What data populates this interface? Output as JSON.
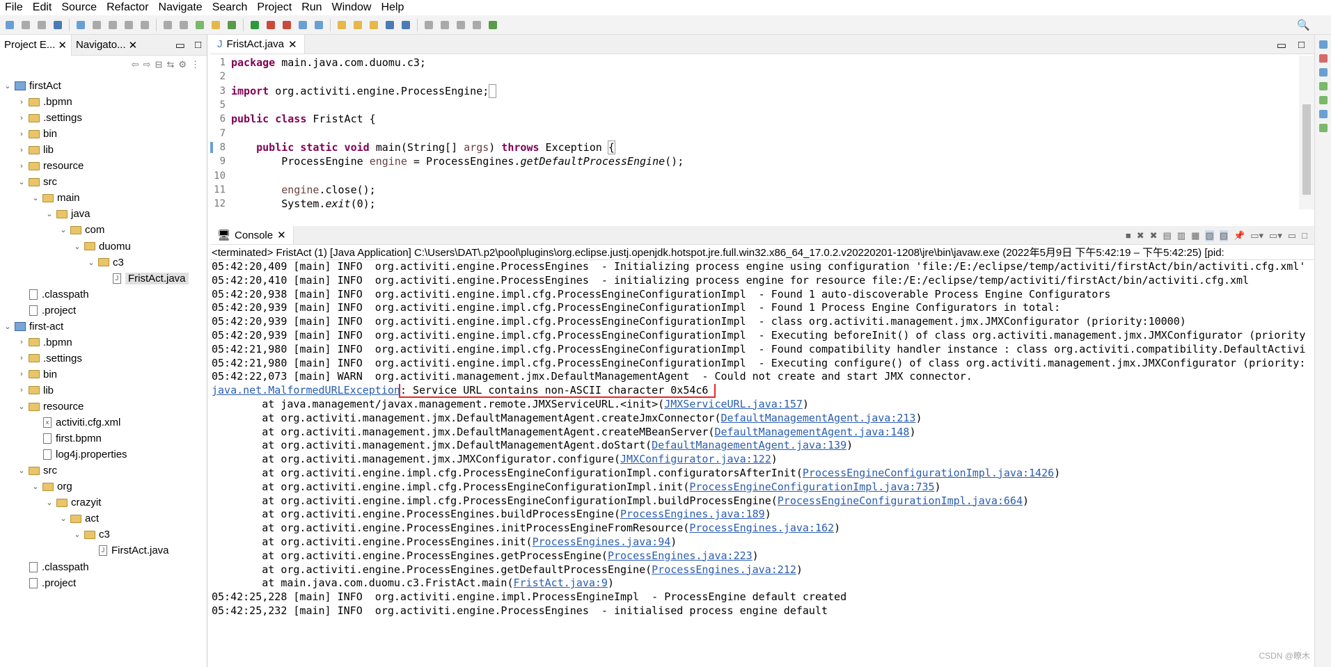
{
  "menu": [
    "File",
    "Edit",
    "Source",
    "Refactor",
    "Navigate",
    "Search",
    "Project",
    "Run",
    "Window",
    "Help"
  ],
  "left_panel": {
    "tabs": [
      "Project E...",
      "Navigato..."
    ],
    "tree": [
      {
        "label": "firstAct",
        "depth": 0,
        "type": "project",
        "expanded": true
      },
      {
        "label": ".bpmn",
        "depth": 1,
        "type": "folder"
      },
      {
        "label": ".settings",
        "depth": 1,
        "type": "folder"
      },
      {
        "label": "bin",
        "depth": 1,
        "type": "folder"
      },
      {
        "label": "lib",
        "depth": 1,
        "type": "folder"
      },
      {
        "label": "resource",
        "depth": 1,
        "type": "folder"
      },
      {
        "label": "src",
        "depth": 1,
        "type": "folder",
        "expanded": true
      },
      {
        "label": "main",
        "depth": 2,
        "type": "folder",
        "expanded": true
      },
      {
        "label": "java",
        "depth": 3,
        "type": "folder",
        "expanded": true
      },
      {
        "label": "com",
        "depth": 4,
        "type": "folder",
        "expanded": true
      },
      {
        "label": "duomu",
        "depth": 5,
        "type": "folder",
        "expanded": true
      },
      {
        "label": "c3",
        "depth": 6,
        "type": "folder",
        "expanded": true
      },
      {
        "label": "FristAct.java",
        "depth": 7,
        "type": "file",
        "selected": true
      },
      {
        "label": ".classpath",
        "depth": 1,
        "type": "file"
      },
      {
        "label": ".project",
        "depth": 1,
        "type": "file"
      },
      {
        "label": "first-act",
        "depth": 0,
        "type": "project",
        "expanded": true
      },
      {
        "label": ".bpmn",
        "depth": 1,
        "type": "folder"
      },
      {
        "label": ".settings",
        "depth": 1,
        "type": "folder"
      },
      {
        "label": "bin",
        "depth": 1,
        "type": "folder"
      },
      {
        "label": "lib",
        "depth": 1,
        "type": "folder"
      },
      {
        "label": "resource",
        "depth": 1,
        "type": "folder",
        "expanded": true
      },
      {
        "label": "activiti.cfg.xml",
        "depth": 2,
        "type": "file"
      },
      {
        "label": "first.bpmn",
        "depth": 2,
        "type": "file"
      },
      {
        "label": "log4j.properties",
        "depth": 2,
        "type": "file"
      },
      {
        "label": "src",
        "depth": 1,
        "type": "folder",
        "expanded": true
      },
      {
        "label": "org",
        "depth": 2,
        "type": "folder",
        "expanded": true
      },
      {
        "label": "crazyit",
        "depth": 3,
        "type": "folder",
        "expanded": true
      },
      {
        "label": "act",
        "depth": 4,
        "type": "folder",
        "expanded": true
      },
      {
        "label": "c3",
        "depth": 5,
        "type": "folder",
        "expanded": true
      },
      {
        "label": "FirstAct.java",
        "depth": 6,
        "type": "file"
      },
      {
        "label": ".classpath",
        "depth": 1,
        "type": "file"
      },
      {
        "label": ".project",
        "depth": 1,
        "type": "file"
      }
    ]
  },
  "editor": {
    "tab": "FristAct.java",
    "lines": [
      {
        "n": "1",
        "html": "<span class='kw'>package</span> main.java.com.duomu.c3;"
      },
      {
        "n": "2",
        "html": ""
      },
      {
        "n": "3",
        "html": "<span class='kw'>import</span> org.activiti.engine.ProcessEngine;<span style='border:1px solid #999'>&nbsp;</span>"
      },
      {
        "n": "5",
        "html": ""
      },
      {
        "n": "6",
        "html": "<span class='kw'>public class</span> FristAct {"
      },
      {
        "n": "7",
        "html": ""
      },
      {
        "n": "8",
        "html": "    <span class='kw'>public static void</span> main(String[] <span class='par'>args</span>) <span class='kw'>throws</span> Exception <span style='outline:1px solid #999'>{</span>"
      },
      {
        "n": "9",
        "html": "        ProcessEngine <span class='par'>engine</span> = ProcessEngines.<span class='it'>getDefaultProcessEngine</span>();"
      },
      {
        "n": "10",
        "html": ""
      },
      {
        "n": "11",
        "html": "        <span class='par'>engine</span>.close();"
      },
      {
        "n": "12",
        "html": "        System.<span class='it'>exit</span>(0);"
      }
    ]
  },
  "console": {
    "tab": "Console",
    "terminated": "<terminated> FristAct (1) [Java Application] C:\\Users\\DAT\\.p2\\pool\\plugins\\org.eclipse.justj.openjdk.hotspot.jre.full.win32.x86_64_17.0.2.v20220201-1208\\jre\\bin\\javaw.exe  (2022年5月9日 下午5:42:19 – 下午5:42:25) [pid:",
    "lines": [
      {
        "t": "05:42:20,409 [main] INFO  org.activiti.engine.ProcessEngines  - Initializing process engine using configuration 'file:/E:/eclipse/temp/activiti/firstAct/bin/activiti.cfg.xml'"
      },
      {
        "t": "05:42:20,410 [main] INFO  org.activiti.engine.ProcessEngines  - initializing process engine for resource file:/E:/eclipse/temp/activiti/firstAct/bin/activiti.cfg.xml"
      },
      {
        "t": "05:42:20,938 [main] INFO  org.activiti.engine.impl.cfg.ProcessEngineConfigurationImpl  - Found 1 auto-discoverable Process Engine Configurators"
      },
      {
        "t": "05:42:20,939 [main] INFO  org.activiti.engine.impl.cfg.ProcessEngineConfigurationImpl  - Found 1 Process Engine Configurators in total:"
      },
      {
        "t": "05:42:20,939 [main] INFO  org.activiti.engine.impl.cfg.ProcessEngineConfigurationImpl  - class org.activiti.management.jmx.JMXConfigurator (priority:10000)"
      },
      {
        "t": "05:42:20,939 [main] INFO  org.activiti.engine.impl.cfg.ProcessEngineConfigurationImpl  - Executing beforeInit() of class org.activiti.management.jmx.JMXConfigurator (priority"
      },
      {
        "t": "05:42:21,980 [main] INFO  org.activiti.engine.impl.cfg.ProcessEngineConfigurationImpl  - Found compatibility handler instance : class org.activiti.compatibility.DefaultActivi"
      },
      {
        "t": "05:42:21,980 [main] INFO  org.activiti.engine.impl.cfg.ProcessEngineConfigurationImpl  - Executing configure() of class org.activiti.management.jmx.JMXConfigurator (priority:"
      },
      {
        "t": "05:42:22,073 [main] WARN  org.activiti.management.jmx.DefaultManagementAgent  - Could not create and start JMX connector."
      },
      {
        "link": "java.net.MalformedURLException",
        "hl": ": Service URL contains non-ASCII character 0x54c6 "
      },
      {
        "t": "        at java.management/javax.management.remote.JMXServiceURL.<init>(",
        "link": "JMXServiceURL.java:157",
        "after": ")"
      },
      {
        "t": "        at org.activiti.management.jmx.DefaultManagementAgent.createJmxConnector(",
        "link": "DefaultManagementAgent.java:213",
        "after": ")"
      },
      {
        "t": "        at org.activiti.management.jmx.DefaultManagementAgent.createMBeanServer(",
        "link": "DefaultManagementAgent.java:148",
        "after": ")"
      },
      {
        "t": "        at org.activiti.management.jmx.DefaultManagementAgent.doStart(",
        "link": "DefaultManagementAgent.java:139",
        "after": ")"
      },
      {
        "t": "        at org.activiti.management.jmx.JMXConfigurator.configure(",
        "link": "JMXConfigurator.java:122",
        "after": ")"
      },
      {
        "t": "        at org.activiti.engine.impl.cfg.ProcessEngineConfigurationImpl.configuratorsAfterInit(",
        "link": "ProcessEngineConfigurationImpl.java:1426",
        "after": ")"
      },
      {
        "t": "        at org.activiti.engine.impl.cfg.ProcessEngineConfigurationImpl.init(",
        "link": "ProcessEngineConfigurationImpl.java:735",
        "after": ")"
      },
      {
        "t": "        at org.activiti.engine.impl.cfg.ProcessEngineConfigurationImpl.buildProcessEngine(",
        "link": "ProcessEngineConfigurationImpl.java:664",
        "after": ")"
      },
      {
        "t": "        at org.activiti.engine.ProcessEngines.buildProcessEngine(",
        "link": "ProcessEngines.java:189",
        "after": ")"
      },
      {
        "t": "        at org.activiti.engine.ProcessEngines.initProcessEngineFromResource(",
        "link": "ProcessEngines.java:162",
        "after": ")"
      },
      {
        "t": "        at org.activiti.engine.ProcessEngines.init(",
        "link": "ProcessEngines.java:94",
        "after": ")"
      },
      {
        "t": "        at org.activiti.engine.ProcessEngines.getProcessEngine(",
        "link": "ProcessEngines.java:223",
        "after": ")"
      },
      {
        "t": "        at org.activiti.engine.ProcessEngines.getDefaultProcessEngine(",
        "link": "ProcessEngines.java:212",
        "after": ")"
      },
      {
        "t": "        at main.java.com.duomu.c3.FristAct.main(",
        "link": "FristAct.java:9",
        "after": ")"
      },
      {
        "t": "05:42:25,228 [main] INFO  org.activiti.engine.impl.ProcessEngineImpl  - ProcessEngine default created"
      },
      {
        "t": "05:42:25,232 [main] INFO  org.activiti.engine.ProcessEngines  - initialised process engine default"
      }
    ]
  },
  "watermark": "CSDN @瞭木",
  "colors": {
    "highlight_box": "#e3262b",
    "link": "#2a5db0",
    "keyword": "#7f0055"
  }
}
